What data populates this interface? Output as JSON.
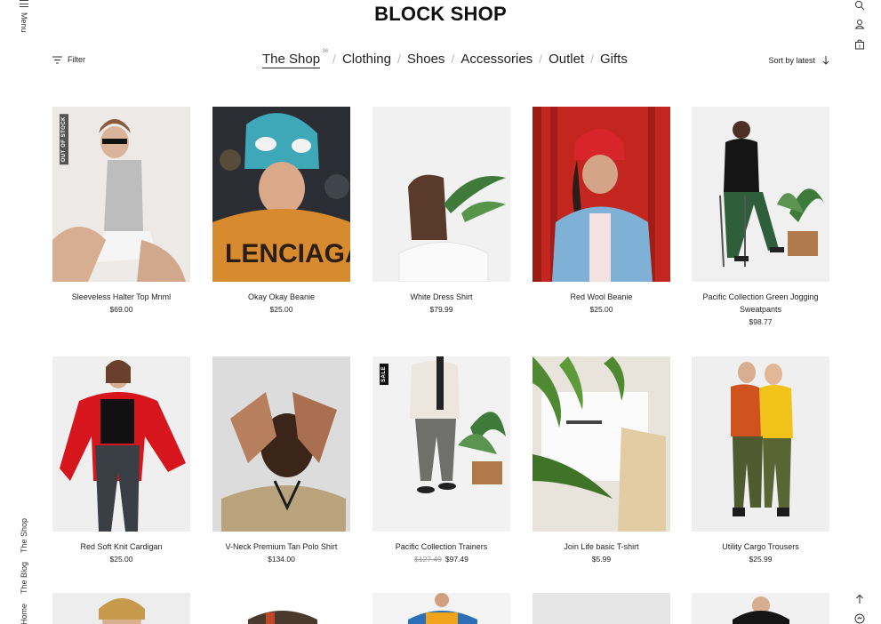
{
  "brand": {
    "logo": "BLOCK SHOP"
  },
  "left_rail": {
    "menu": "Menu",
    "links": [
      "The Shop",
      "The Blog",
      "Home"
    ]
  },
  "toolbar": {
    "filter_label": "Filter",
    "sort_label": "Sort by latest"
  },
  "nav": {
    "items": [
      "The Shop",
      "Clothing",
      "Shoes",
      "Accessories",
      "Outlet",
      "Gifts"
    ],
    "active_index": 0,
    "shop_count": "36"
  },
  "right_rail_icons": [
    "search-icon",
    "account-icon",
    "cart-icon",
    "back-to-top-icon",
    "chat-icon"
  ],
  "products": [
    {
      "name": "Sleeveless Halter Top Mnml",
      "price": "$69.00",
      "badge": "OUT OF STOCK"
    },
    {
      "name": "Okay Okay Beanie",
      "price": "$25.00"
    },
    {
      "name": "White Dress Shirt",
      "price": "$79.99"
    },
    {
      "name": "Red Wool Beanie",
      "price": "$25.00"
    },
    {
      "name": "Pacific Collection Green Jogging Sweatpants",
      "price": "$98.77"
    },
    {
      "name": "Red Soft Knit Cardigan",
      "price": "$25.00"
    },
    {
      "name": "V-Neck Premium Tan Polo Shirt",
      "price": "$134.00"
    },
    {
      "name": "Pacific Collection Trainers",
      "old_price": "$127.49",
      "price": "$97.49",
      "badge": "SALE"
    },
    {
      "name": "Join Life basic T-shirt",
      "price": "$5.99"
    },
    {
      "name": "Utility Cargo Trousers",
      "price": "$25.99"
    }
  ],
  "colors": {
    "text": "#111111",
    "badge": "#111111",
    "muted": "#999999"
  }
}
